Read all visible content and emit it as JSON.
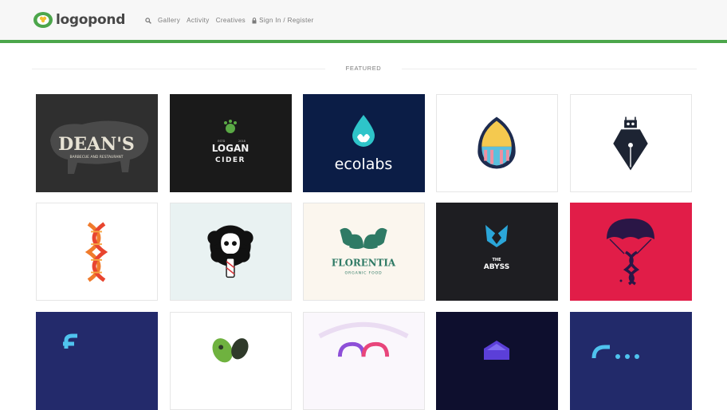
{
  "header": {
    "logo_text": "logopond",
    "nav": {
      "gallery": "Gallery",
      "activity": "Activity",
      "creatives": "Creatives",
      "sign_in": "Sign In / Register"
    }
  },
  "section": {
    "featured_label": "FEATURED"
  },
  "cards": [
    {
      "title": "DEAN'S",
      "subtitle": "BARBECUE AND RESTAURANT"
    },
    {
      "title_line1": "LOGAN",
      "title_line2": "CIDER",
      "est_left": "ESTD",
      "est_right": "2018"
    },
    {
      "title": "ecolabs"
    },
    {
      "title": ""
    },
    {
      "title": ""
    },
    {
      "title": ""
    },
    {
      "title": ""
    },
    {
      "title": "FLORENTIA",
      "subtitle": "ORGANIC FOOD"
    },
    {
      "title_line1": "THE",
      "title_line2": "ABYSS"
    },
    {
      "title": ""
    }
  ],
  "colors": {
    "accent_green": "#4ca64b",
    "header_bg": "#f7f7f7",
    "ecolabs_bg": "#0b1d46",
    "red_card_bg": "#e11d48"
  }
}
